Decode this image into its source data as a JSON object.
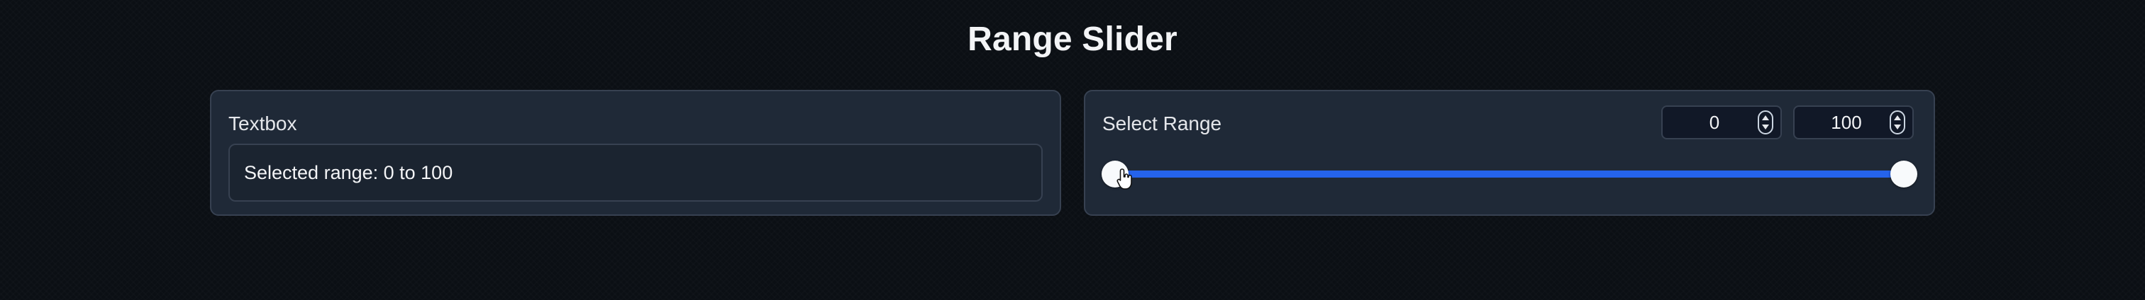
{
  "page": {
    "title": "Range Slider"
  },
  "textbox_panel": {
    "label": "Textbox",
    "value": "Selected range: 0 to 100"
  },
  "range_panel": {
    "label": "Select Range",
    "min_value": "0",
    "max_value": "100",
    "slider": {
      "min": 0,
      "max": 100,
      "low": 0,
      "high": 100
    }
  },
  "icons": {
    "spinner_icon": "spinner-icon",
    "cursor_icon": "hand-pointer-icon"
  },
  "colors": {
    "background": "#0b0f14",
    "panel": "#1f2937",
    "accent": "#2563eb",
    "thumb": "#f8fafc"
  }
}
